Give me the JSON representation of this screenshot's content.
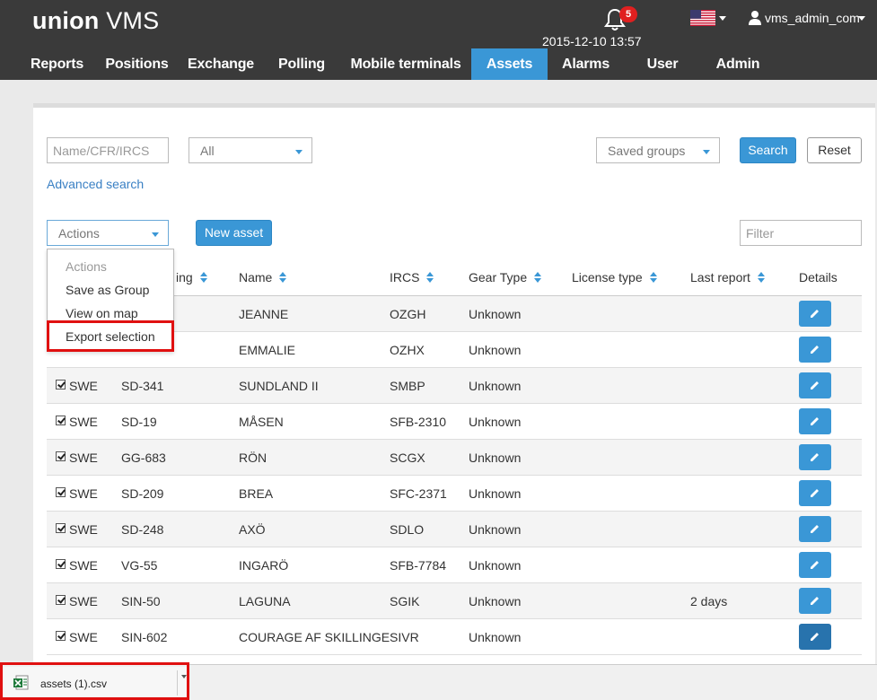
{
  "header": {
    "logo_bold": "union",
    "logo_light": "VMS",
    "notification_count": "5",
    "datetime": "2015-12-10 13:57",
    "username": "vms_admin_com"
  },
  "nav": {
    "items": [
      {
        "label": "Reports",
        "active": false
      },
      {
        "label": "Positions",
        "active": false
      },
      {
        "label": "Exchange",
        "active": false
      },
      {
        "label": "Polling",
        "active": false
      },
      {
        "label": "Mobile terminals",
        "active": false
      },
      {
        "label": "Assets",
        "active": true
      },
      {
        "label": "Alarms",
        "active": false
      },
      {
        "label": "User",
        "active": false
      },
      {
        "label": "Admin",
        "active": false
      }
    ]
  },
  "search": {
    "name_placeholder": "Name/CFR/IRCS",
    "type_select": "All",
    "saved_groups": "Saved groups",
    "search_label": "Search",
    "reset_label": "Reset",
    "advanced_link": "Advanced search"
  },
  "toolbar": {
    "actions_label": "Actions",
    "new_asset_label": "New asset",
    "filter_placeholder": "Filter"
  },
  "actions_menu": {
    "items": [
      "Actions",
      "Save as Group",
      "View on map",
      "Export selection"
    ]
  },
  "table": {
    "headers": {
      "marking_partial": "ing",
      "name": "Name",
      "ircs": "IRCS",
      "gear_type": "Gear Type",
      "license_type": "License type",
      "last_report": "Last report",
      "details": "Details"
    },
    "rows": [
      {
        "flag": "",
        "cfr": "",
        "name": "JEANNE",
        "ircs": "OZGH",
        "gear": "Unknown",
        "license": "",
        "last_report": ""
      },
      {
        "flag": "",
        "cfr": "",
        "name": "EMMALIE",
        "ircs": "OZHX",
        "gear": "Unknown",
        "license": "",
        "last_report": ""
      },
      {
        "flag": "SWE",
        "cfr": "SD-341",
        "name": "SUNDLAND II",
        "ircs": "SMBP",
        "gear": "Unknown",
        "license": "",
        "last_report": ""
      },
      {
        "flag": "SWE",
        "cfr": "SD-19",
        "name": "MÅSEN",
        "ircs": "SFB-2310",
        "gear": "Unknown",
        "license": "",
        "last_report": ""
      },
      {
        "flag": "SWE",
        "cfr": "GG-683",
        "name": "RÖN",
        "ircs": "SCGX",
        "gear": "Unknown",
        "license": "",
        "last_report": ""
      },
      {
        "flag": "SWE",
        "cfr": "SD-209",
        "name": "BREA",
        "ircs": "SFC-2371",
        "gear": "Unknown",
        "license": "",
        "last_report": ""
      },
      {
        "flag": "SWE",
        "cfr": "SD-248",
        "name": "AXÖ",
        "ircs": "SDLO",
        "gear": "Unknown",
        "license": "",
        "last_report": ""
      },
      {
        "flag": "SWE",
        "cfr": "VG-55",
        "name": "INGARÖ",
        "ircs": "SFB-7784",
        "gear": "Unknown",
        "license": "",
        "last_report": ""
      },
      {
        "flag": "SWE",
        "cfr": "SIN-50",
        "name": "LAGUNA",
        "ircs": "SGIK",
        "gear": "Unknown",
        "license": "",
        "last_report": "2 days"
      },
      {
        "flag": "SWE",
        "cfr": "SIN-602",
        "name": "COURAGE AF SKILLINGE",
        "ircs": "SIVR",
        "gear": "Unknown",
        "license": "",
        "last_report": ""
      }
    ]
  },
  "download": {
    "filename": "assets (1).csv"
  },
  "colors": {
    "accent": "#3a97d6",
    "header_bg": "#3a3a3a",
    "highlight": "#e01010",
    "badge": "#e02020"
  }
}
